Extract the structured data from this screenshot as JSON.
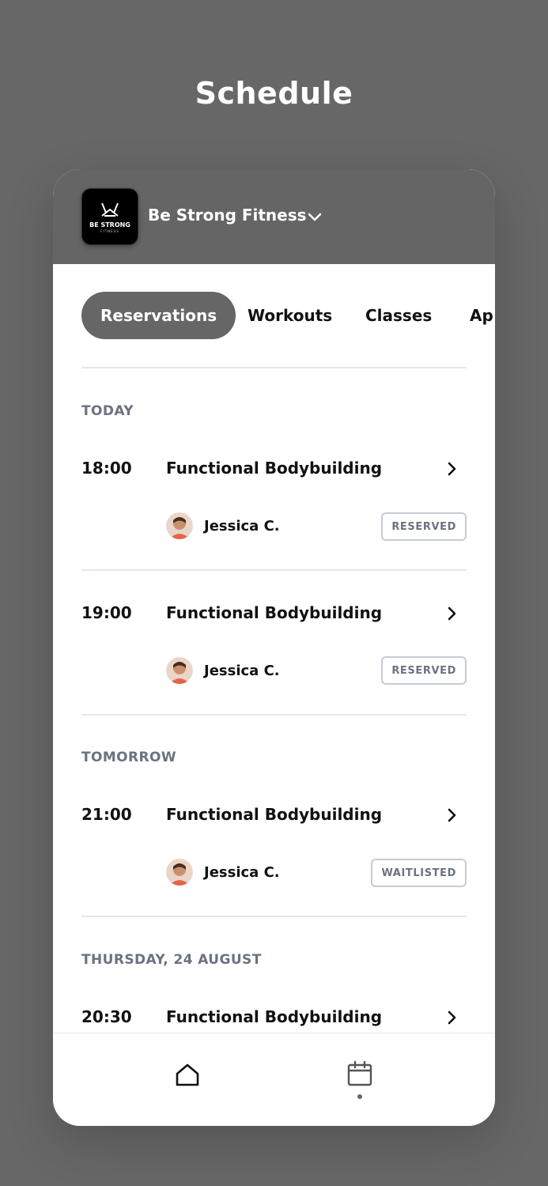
{
  "title": "Schedule",
  "header": {
    "gym_name": "Be Strong Fitness",
    "logo_text": "BE STRONG",
    "logo_subtext": "FITNESS"
  },
  "tabs": [
    {
      "label": "Reservations",
      "active": true
    },
    {
      "label": "Workouts",
      "active": false
    },
    {
      "label": "Classes",
      "active": false
    },
    {
      "label": "Ap",
      "active": false
    }
  ],
  "sections": [
    {
      "label": "TODAY",
      "items": [
        {
          "time": "18:00",
          "class": "Functional Bodybuilding",
          "coach": "Jessica C.",
          "status": "RESERVED"
        },
        {
          "time": "19:00",
          "class": "Functional Bodybuilding",
          "coach": "Jessica C.",
          "status": "RESERVED"
        }
      ]
    },
    {
      "label": "TOMORROW",
      "items": [
        {
          "time": "21:00",
          "class": "Functional Bodybuilding",
          "coach": "Jessica C.",
          "status": "WAITLISTED"
        }
      ]
    },
    {
      "label": "THURSDAY, 24 AUGUST",
      "items": [
        {
          "time": "20:30",
          "class": "Functional Bodybuilding"
        }
      ]
    }
  ],
  "bottom_nav": [
    {
      "icon": "home-icon",
      "active": false
    },
    {
      "icon": "calendar-icon",
      "active": true
    }
  ],
  "colors": {
    "background": "#676767",
    "accent": "#666666",
    "badge_border": "#c7cbd4",
    "muted_text": "#6b7280"
  }
}
